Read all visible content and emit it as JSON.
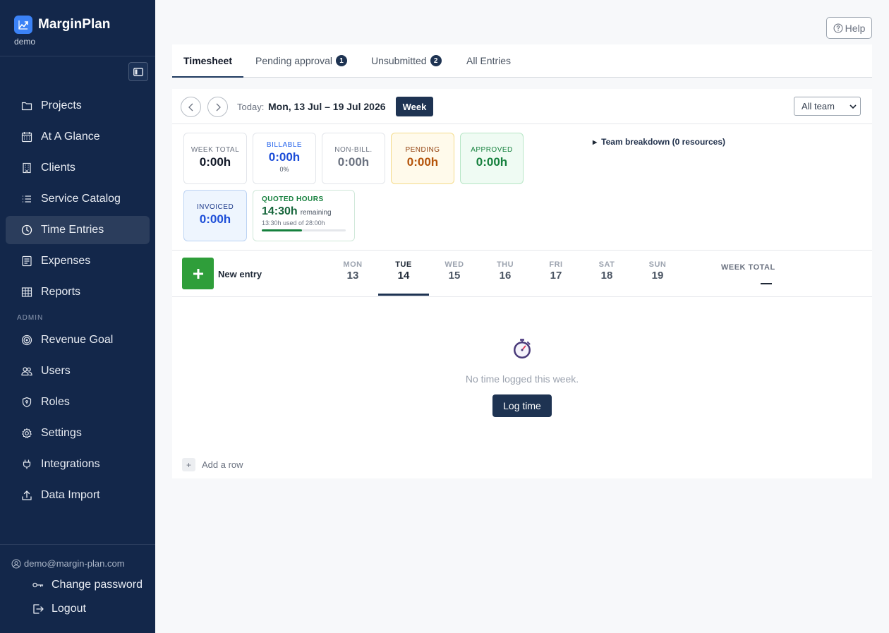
{
  "brand": {
    "name": "MarginPlan",
    "sub": "demo",
    "logo_icon": "chart-trend-icon"
  },
  "nav": {
    "items": [
      {
        "label": "Projects",
        "icon": "folder-icon"
      },
      {
        "label": "At A Glance",
        "icon": "calendar-grid-icon"
      },
      {
        "label": "Clients",
        "icon": "building-icon"
      },
      {
        "label": "Service Catalog",
        "icon": "list-icon"
      },
      {
        "label": "Time Entries",
        "icon": "clock-icon",
        "active": true
      },
      {
        "label": "Expenses",
        "icon": "receipt-icon"
      },
      {
        "label": "Reports",
        "icon": "table-icon"
      }
    ],
    "admin_label": "ADMIN",
    "admin_items": [
      {
        "label": "Revenue Goal",
        "icon": "target-icon"
      },
      {
        "label": "Users",
        "icon": "users-icon"
      },
      {
        "label": "Roles",
        "icon": "shield-icon"
      },
      {
        "label": "Settings",
        "icon": "gear-icon"
      },
      {
        "label": "Integrations",
        "icon": "plug-icon"
      },
      {
        "label": "Data Import",
        "icon": "upload-icon"
      }
    ]
  },
  "account": {
    "email": "demo@margin-plan.com",
    "change_password": "Change password",
    "logout": "Logout"
  },
  "help_label": "Help",
  "tabs": [
    {
      "label": "Timesheet",
      "active": true
    },
    {
      "label": "Pending approval",
      "badge": "1"
    },
    {
      "label": "Unsubmitted",
      "badge": "2"
    },
    {
      "label": "All Entries"
    }
  ],
  "toolbar": {
    "today_label": "Today:",
    "date_range": "Mon, 13 Jul – 19 Jul 2026",
    "week_label": "Week",
    "team_filter": "All team"
  },
  "stats": {
    "week_total": {
      "label": "WEEK TOTAL",
      "value": "0:00h"
    },
    "billable": {
      "label": "BILLABLE",
      "value": "0:00h",
      "sub": "0%"
    },
    "non_billable": {
      "label": "NON-BILL.",
      "value": "0:00h"
    },
    "pending": {
      "label": "PENDING",
      "value": "0:00h"
    },
    "approved": {
      "label": "APPROVED",
      "value": "0:00h"
    },
    "invoiced": {
      "label": "INVOICED",
      "value": "0:00h"
    },
    "quoted": {
      "label": "QUOTED HOURS",
      "value": "14:30h",
      "remaining": "remaining",
      "used": "13:30h used of 28:00h",
      "progress_fraction": 0.482
    }
  },
  "team_breakdown": "Team breakdown (0 resources)",
  "grid": {
    "new_entry_label": "New entry",
    "days": [
      {
        "name": "MON",
        "date": "13"
      },
      {
        "name": "TUE",
        "date": "14",
        "active": true
      },
      {
        "name": "WED",
        "date": "15"
      },
      {
        "name": "THU",
        "date": "16"
      },
      {
        "name": "FRI",
        "date": "17"
      },
      {
        "name": "SAT",
        "date": "18"
      },
      {
        "name": "SUN",
        "date": "19"
      }
    ],
    "week_total_label": "WEEK TOTAL"
  },
  "empty": {
    "message": "No time logged this week.",
    "button": "Log time"
  },
  "add_row": {
    "plus": "+",
    "label": "Add a row"
  },
  "colors": {
    "sidebar_bg": "#13274a",
    "accent_dark": "#1e3352",
    "success_green": "#2f9e3a",
    "billable_blue": "#1d4ed8",
    "pending_orange": "#b45309",
    "approved_green": "#15803d"
  }
}
